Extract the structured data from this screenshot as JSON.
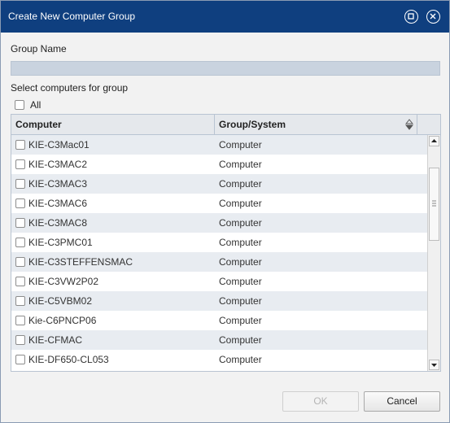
{
  "dialog": {
    "title": "Create New Computer Group",
    "restore_icon": "restore-icon",
    "close_icon": "close-icon"
  },
  "form": {
    "group_name_label": "Group Name",
    "group_name_value": "",
    "select_label": "Select computers for group",
    "all_label": "All"
  },
  "grid": {
    "columns": [
      "Computer",
      "Group/System"
    ],
    "sort_icon": "sort-updown-icon",
    "rows": [
      {
        "name": "KIE-C3Mac01",
        "type": "Computer"
      },
      {
        "name": "KIE-C3MAC2",
        "type": "Computer"
      },
      {
        "name": "KIE-C3MAC3",
        "type": "Computer"
      },
      {
        "name": "KIE-C3MAC6",
        "type": "Computer"
      },
      {
        "name": "KIE-C3MAC8",
        "type": "Computer"
      },
      {
        "name": "KIE-C3PMC01",
        "type": "Computer"
      },
      {
        "name": "KIE-C3STEFFENSMAC",
        "type": "Computer"
      },
      {
        "name": "KIE-C3VW2P02",
        "type": "Computer"
      },
      {
        "name": "KIE-C5VBM02",
        "type": "Computer"
      },
      {
        "name": "Kie-C6PNCP06",
        "type": "Computer"
      },
      {
        "name": "KIE-CFMAC",
        "type": "Computer"
      },
      {
        "name": "KIE-DF650-CL053",
        "type": "Computer"
      }
    ]
  },
  "buttons": {
    "ok_label": "OK",
    "cancel_label": "Cancel"
  },
  "colors": {
    "titlebar": "#0f3f7f",
    "row_alt": "#e8ecf1"
  }
}
